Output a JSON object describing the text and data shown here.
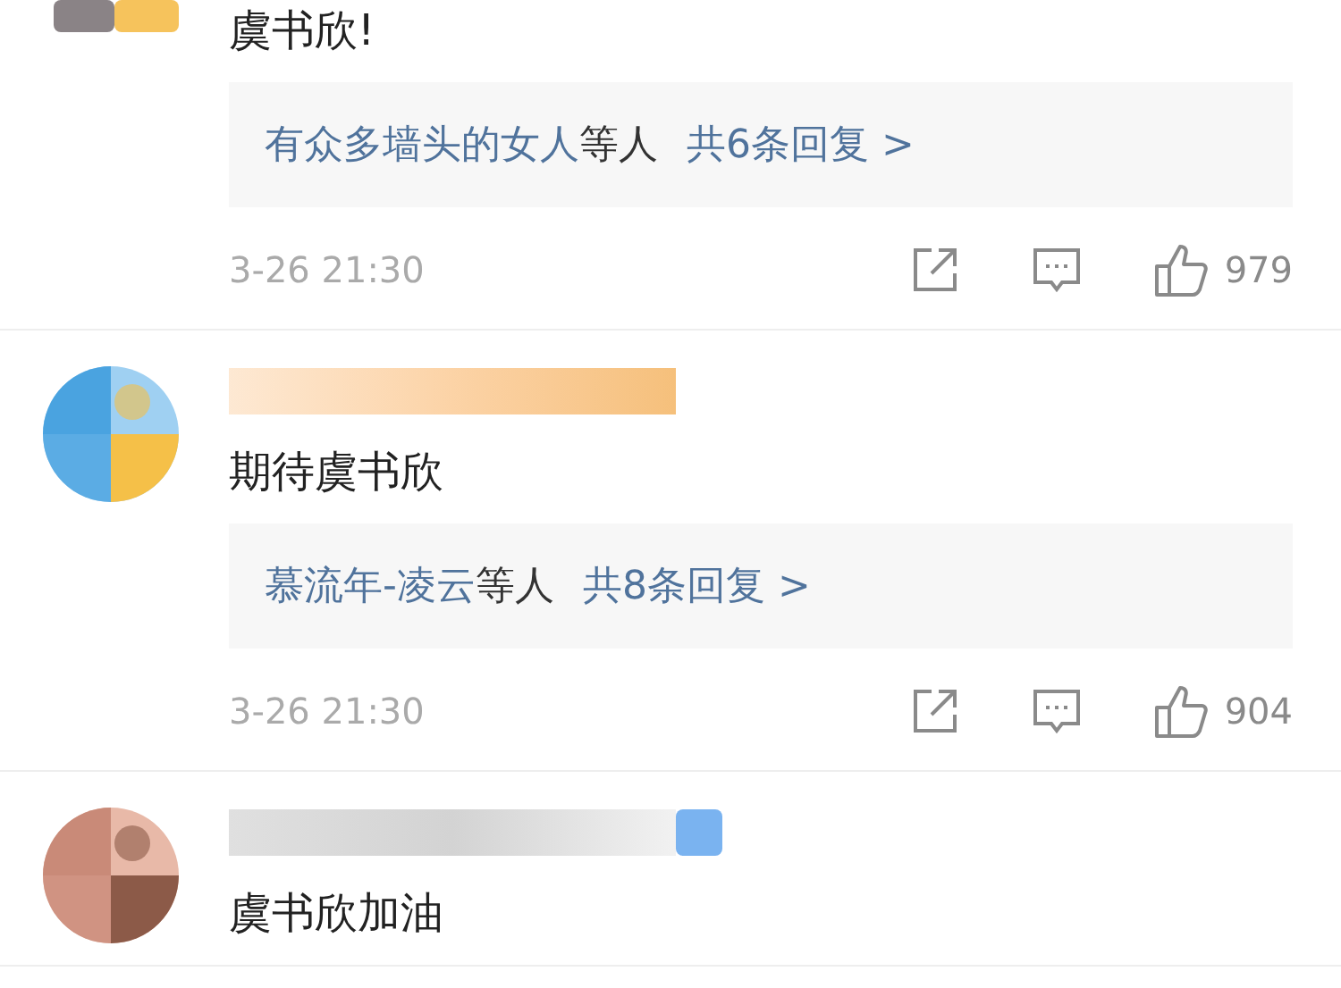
{
  "comments": [
    {
      "kind": "cut",
      "text": "虞书欣!",
      "replies": {
        "names": "有众多墙头的女人",
        "suffix": "等人",
        "count": "共6条回复 >"
      },
      "time": "3-26 21:30",
      "likes": "979"
    },
    {
      "kind": "full",
      "text": "期待虞书欣",
      "replies": {
        "names": "慕流年-凌云",
        "suffix": "等人",
        "count": "共8条回复 >"
      },
      "time": "3-26 21:30",
      "likes": "904"
    },
    {
      "kind": "full",
      "badge": true,
      "text": "虞书欣加油"
    }
  ]
}
